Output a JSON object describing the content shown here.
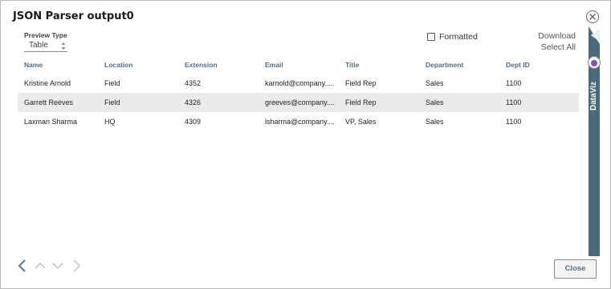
{
  "dialog": {
    "title": "JSON Parser output0"
  },
  "preview": {
    "label": "Preview Type",
    "value": "Table"
  },
  "toolbar": {
    "formatted_label": "Formatted",
    "formatted_checked": false,
    "download_label": "Download",
    "select_all_label": "Select All"
  },
  "table": {
    "columns": [
      "Name",
      "Location",
      "Extension",
      "Email",
      "Title",
      "Department",
      "Dept ID"
    ],
    "rows": [
      [
        "Kristine Arnold",
        "Field",
        "4352",
        "karnold@company....",
        "Field Rep",
        "Sales",
        "1100"
      ],
      [
        "Garrett Reeves",
        "Field",
        "4326",
        "greeves@company....",
        "Field Rep",
        "Sales",
        "1100"
      ],
      [
        "Laxman Sharma",
        "HQ",
        "4309",
        "lsharma@company....",
        "VP, Sales",
        "Sales",
        "1100"
      ]
    ]
  },
  "dataviz": {
    "label": "DataViz"
  },
  "footer": {
    "close_label": "Close"
  },
  "colors": {
    "header_text": "#4f6f8a",
    "sidebar": "#4b6b7c",
    "row_alt": "#ebebeb"
  }
}
